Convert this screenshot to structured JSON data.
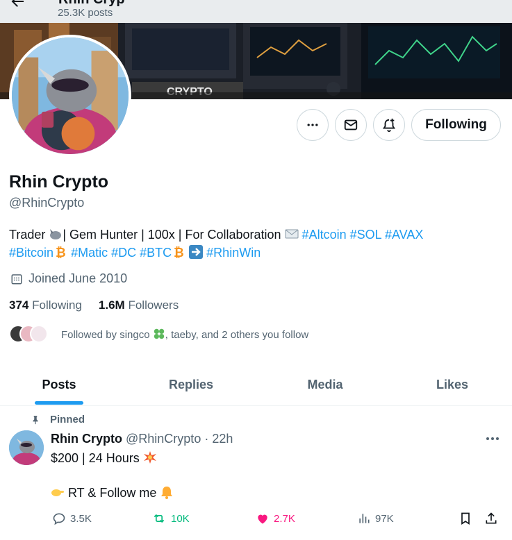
{
  "header": {
    "title_partial": "Rhin Cryp",
    "posts_count": "25.3K posts"
  },
  "banner": {
    "sign_text": "CRYPTO"
  },
  "buttons": {
    "following_label": "Following"
  },
  "profile": {
    "name": "Rhin Crypto",
    "handle": "@RhinCrypto",
    "bio": {
      "part1": "Trader ",
      "part2": "| Gem Hunter | 100x | For Collaboration ",
      "tag_altcoin": "#Altcoin",
      "tag_sol": "#SOL",
      "tag_avax": "#AVAX",
      "tag_bitcoin": "#Bitcoin",
      "tag_matic": "#Matic",
      "tag_dc": "#DC",
      "tag_btc": "#BTC",
      "tag_rhinwin": "#RhinWin"
    },
    "joined": "Joined June 2010",
    "following_count": "374",
    "following_label": "Following",
    "followers_count": "1.6M",
    "followers_label": "Followers",
    "followed_by_prefix": "Followed by singco",
    "followed_by_suffix": ", taeby, and 2 others you follow"
  },
  "tabs": [
    {
      "label": "Posts",
      "active": true
    },
    {
      "label": "Replies",
      "active": false
    },
    {
      "label": "Media",
      "active": false
    },
    {
      "label": "Likes",
      "active": false
    }
  ],
  "tweet": {
    "pinned_label": "Pinned",
    "author_name": "Rhin Crypto",
    "author_handle": "@RhinCrypto",
    "time": " · 22h",
    "line1": "$200 | 24 Hours ",
    "line2": " RT & Follow me ",
    "replies": "3.5K",
    "retweets": "10K",
    "likes": "2.7K",
    "views": "97K"
  },
  "colors": {
    "accent": "#1d9bf0",
    "retweet": "#00ba7c",
    "like": "#f91880",
    "text_secondary": "#536471"
  }
}
